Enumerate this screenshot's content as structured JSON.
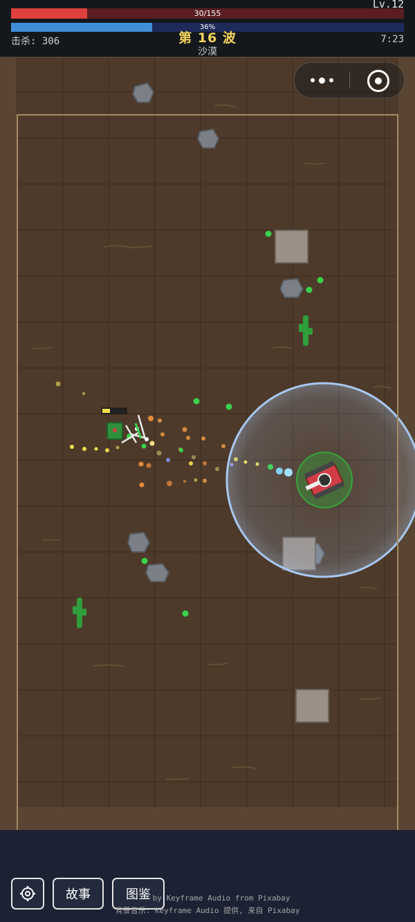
{
  "hud": {
    "hp_text": "30/155",
    "hp_fraction": 0.194,
    "level": "Lv.12",
    "xp_percent_text": "36%",
    "xp_fraction": 0.36,
    "kills": "击杀: 306",
    "wave": "第 16 波",
    "biome": "沙漠",
    "timer": "7:23"
  },
  "colors": {
    "hp": "#e0403e",
    "xp": "#3f8fd8",
    "wave_text": "#f4d35e",
    "ground": "#4e3a2a",
    "arena_border": "#a58b64",
    "shield": "#a8c8f0"
  },
  "capsule": {
    "more_icon": "more-dots-icon",
    "close_icon": "target-circle-icon"
  },
  "buttons": {
    "settings_icon": "gear-icon",
    "story": "故事",
    "codex": "图鉴"
  },
  "credits": {
    "line1": "by Keyframe Audio from Pixabay",
    "line2": "背景音乐: Keyframe Audio 提供, 来自 Pixabay"
  }
}
